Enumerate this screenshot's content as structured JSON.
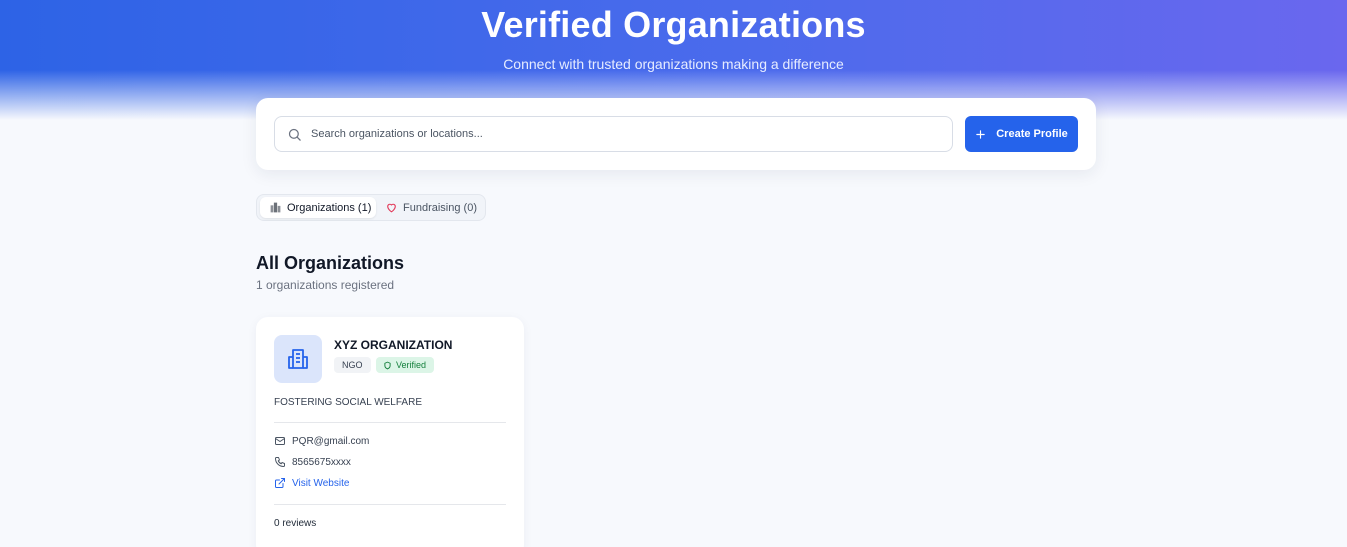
{
  "hero": {
    "title": "Verified Organizations",
    "subtitle": "Connect with trusted organizations making a difference"
  },
  "search": {
    "placeholder": "Search organizations or locations...",
    "value": "",
    "icon": "search-icon"
  },
  "actions": {
    "create_profile_label": "Create Profile",
    "create_icon": "plus-icon"
  },
  "tabs": [
    {
      "label": "Organizations (1)",
      "icon": "organization-icon",
      "active": true
    },
    {
      "label": "Fundraising (0)",
      "icon": "heart-icon",
      "active": false
    }
  ],
  "section": {
    "title": "All Organizations",
    "count_text": "1 organizations registered"
  },
  "organizations": [
    {
      "name": "XYZ ORGANIZATION",
      "type": "NGO",
      "verified_label": "Verified",
      "tagline": "FOSTERING SOCIAL WELFARE",
      "email": "PQR@gmail.com",
      "phone": "8565675xxxx",
      "website_label": "Visit Website",
      "reviews": "0 reviews"
    }
  ],
  "colors": {
    "accent": "#2563eb",
    "hero_start": "#2d63e6",
    "hero_end": "#6a67ee",
    "verified_bg": "#dcf5e7",
    "verified_text": "#15803d"
  }
}
